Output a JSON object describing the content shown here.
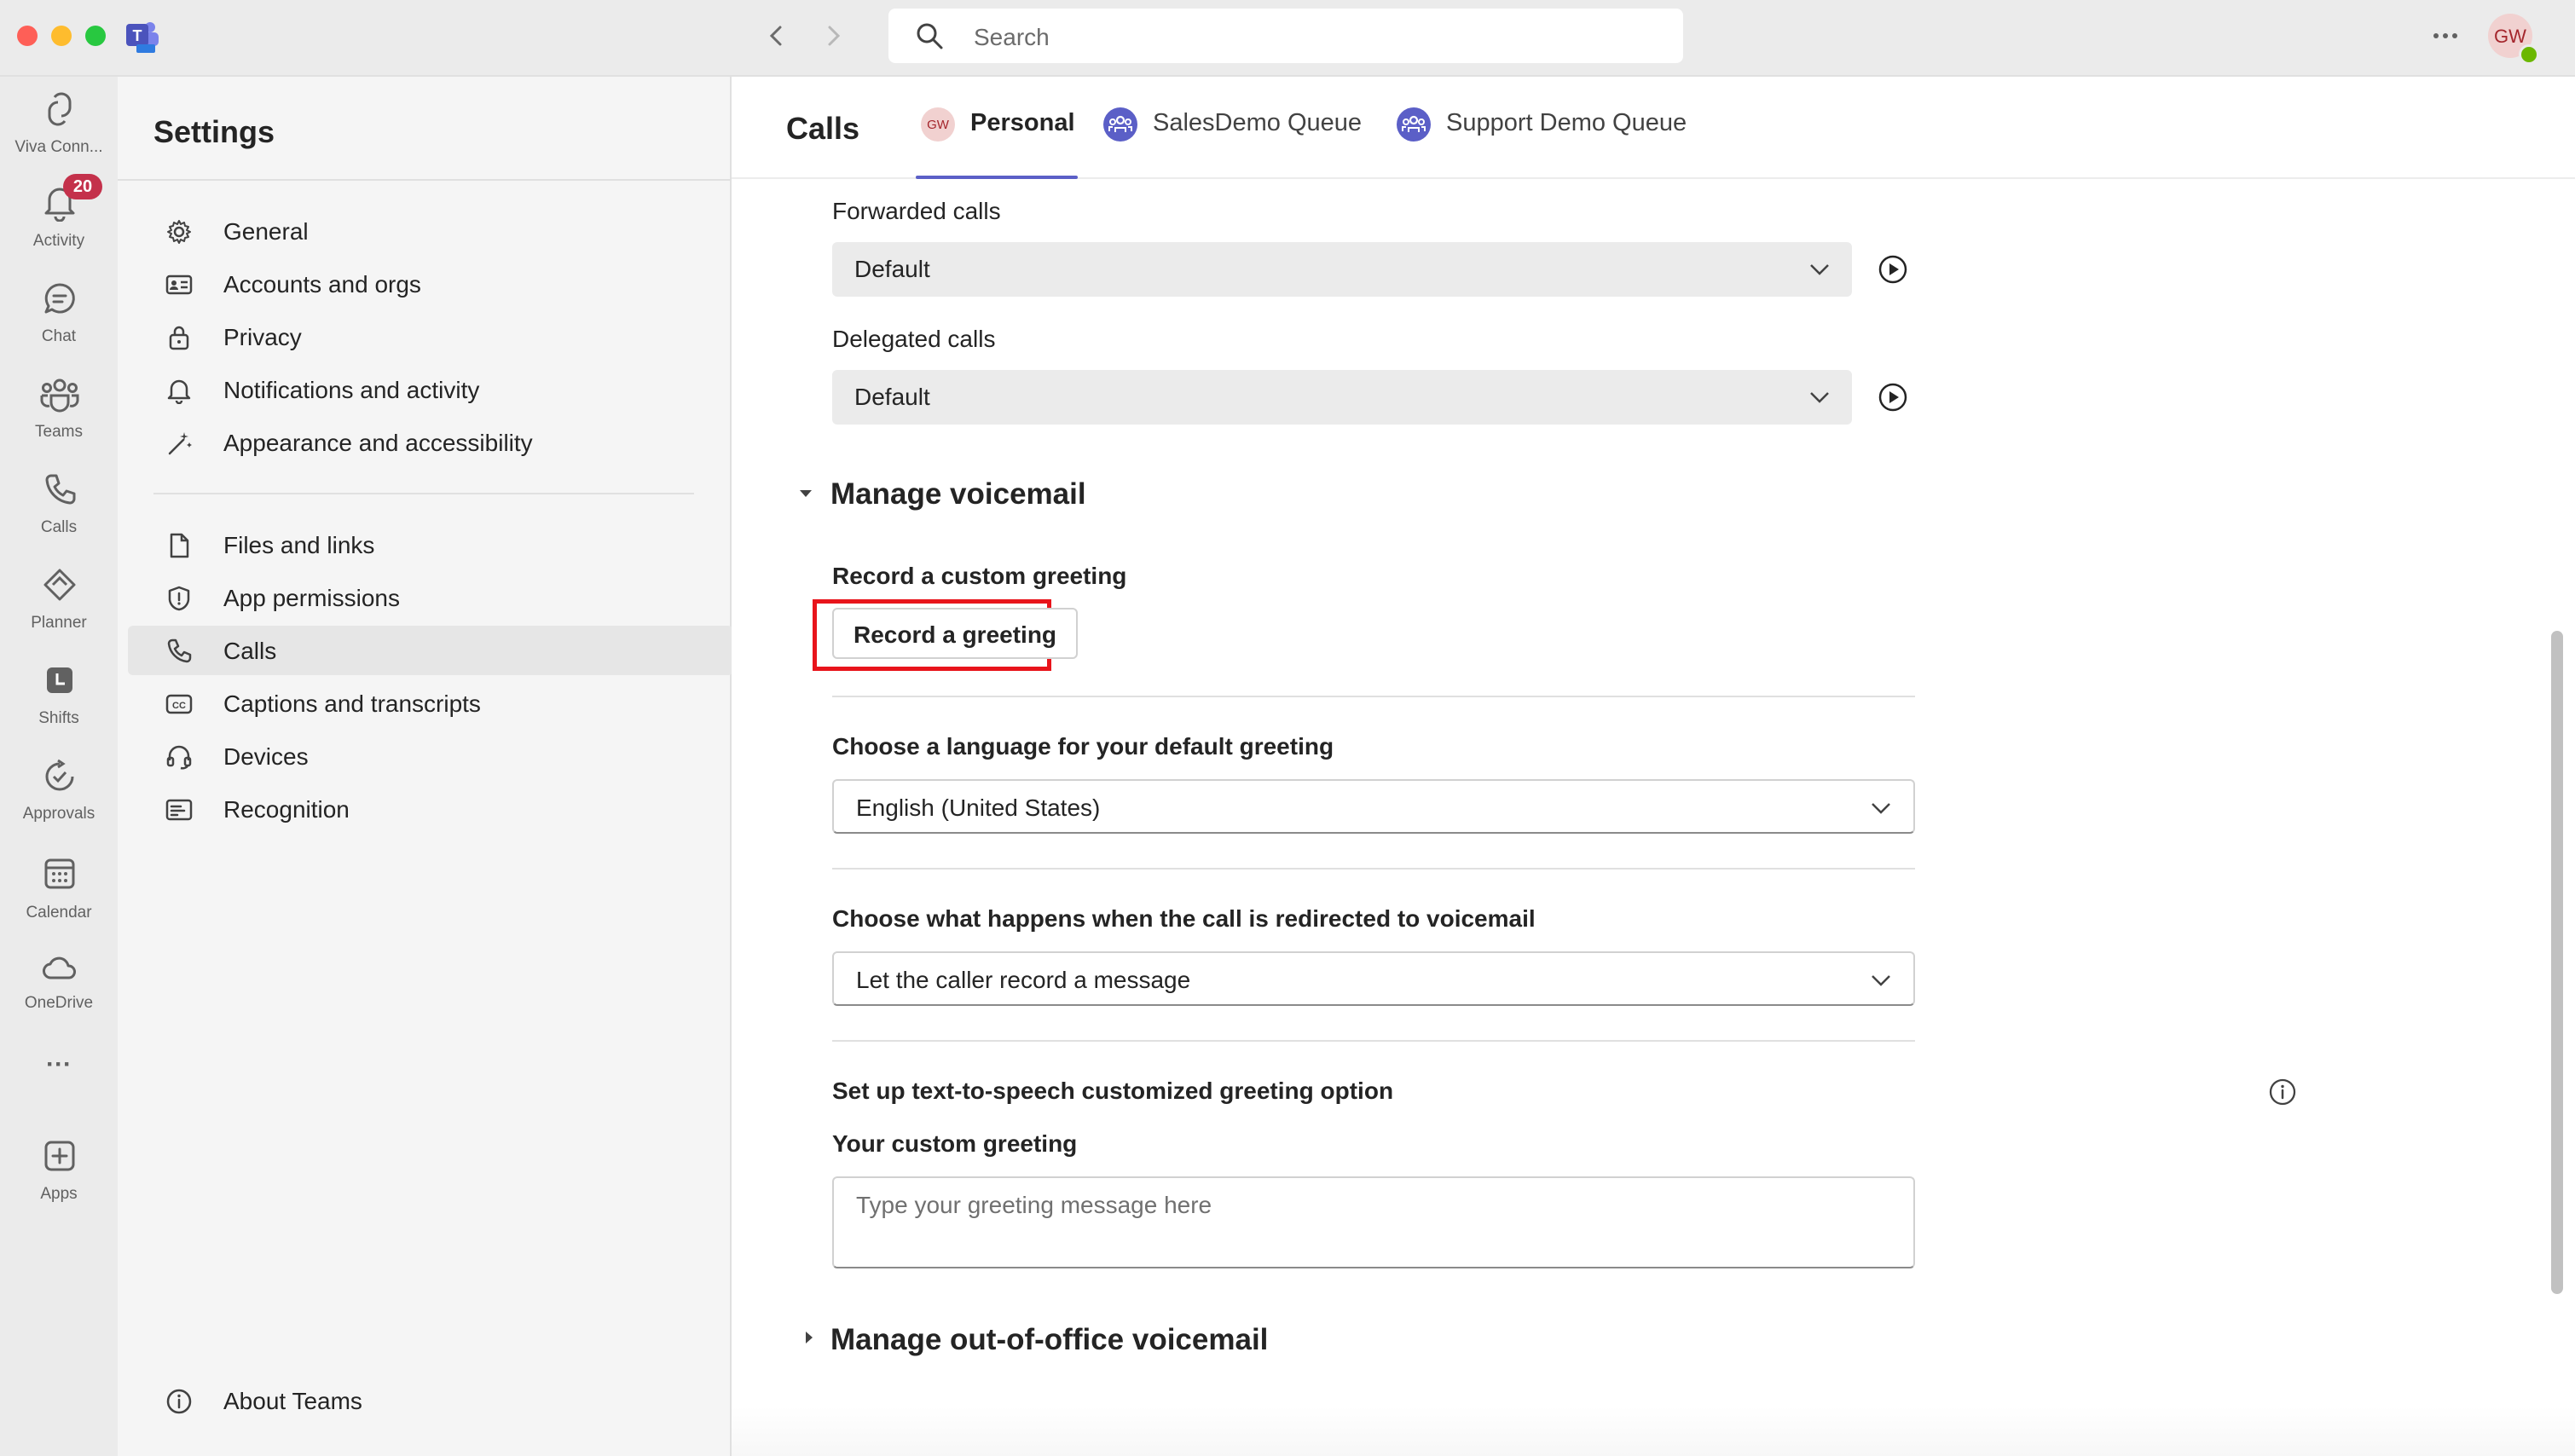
{
  "window": {
    "search_placeholder": "Search"
  },
  "app_rail": {
    "items": [
      {
        "label": "Viva Conn...",
        "icon": "viva-connections-icon"
      },
      {
        "label": "Activity",
        "icon": "bell-icon",
        "badge": "20"
      },
      {
        "label": "Chat",
        "icon": "chat-icon"
      },
      {
        "label": "Teams",
        "icon": "teams-icon"
      },
      {
        "label": "Calls",
        "icon": "phone-icon"
      },
      {
        "label": "Planner",
        "icon": "planner-icon"
      },
      {
        "label": "Shifts",
        "icon": "shifts-icon"
      },
      {
        "label": "Approvals",
        "icon": "approvals-icon"
      },
      {
        "label": "Calendar",
        "icon": "calendar-icon"
      },
      {
        "label": "OneDrive",
        "icon": "cloud-icon"
      },
      {
        "label": "Apps",
        "icon": "add-apps-icon"
      }
    ],
    "more_label": "···"
  },
  "user": {
    "initials": "GW",
    "status_color": "#6bb700"
  },
  "settings_nav": {
    "title": "Settings",
    "items": [
      {
        "label": "General"
      },
      {
        "label": "Accounts and orgs"
      },
      {
        "label": "Privacy"
      },
      {
        "label": "Notifications and activity"
      },
      {
        "label": "Appearance and accessibility"
      },
      {
        "label": "Files and links"
      },
      {
        "label": "App permissions"
      },
      {
        "label": "Calls"
      },
      {
        "label": "Captions and transcripts"
      },
      {
        "label": "Devices"
      },
      {
        "label": "Recognition"
      }
    ],
    "selected": "Calls",
    "about": "About Teams"
  },
  "main": {
    "title": "Calls",
    "tabs": [
      {
        "label": "Personal",
        "avatar": "GW"
      },
      {
        "label": "SalesDemo Queue"
      },
      {
        "label": "Support Demo Queue"
      }
    ],
    "forwarded_calls": {
      "label": "Forwarded calls",
      "value": "Default"
    },
    "delegated_calls": {
      "label": "Delegated calls",
      "value": "Default"
    },
    "manage_voicemail": {
      "heading": "Manage voicemail",
      "record_label": "Record a custom greeting",
      "record_button": "Record a greeting",
      "language_label": "Choose a language for your default greeting",
      "language_value": "English (United States)",
      "redirect_label": "Choose what happens when the call is redirected to voicemail",
      "redirect_value": "Let the caller record a message",
      "tts_label": "Set up text-to-speech customized greeting option",
      "custom_greeting_label": "Your custom greeting",
      "custom_greeting_placeholder": "Type your greeting message here"
    },
    "out_of_office_heading": "Manage out-of-office voicemail",
    "highlight_color": "#e8141b"
  },
  "colors": {
    "accent": "#5b5fc7",
    "badge": "#c4314b"
  }
}
